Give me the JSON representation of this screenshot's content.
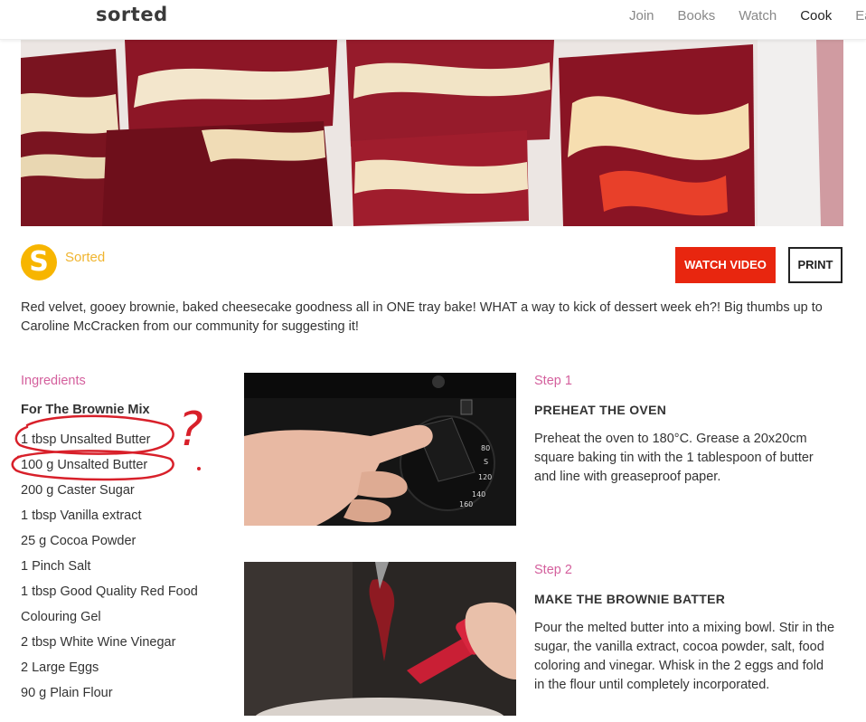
{
  "header": {
    "logo": "sorted",
    "nav": [
      "Join",
      "Books",
      "Watch",
      "Cook",
      "Ea"
    ],
    "active_nav": "Cook"
  },
  "author": {
    "avatar_letter": "S",
    "name": "Sorted"
  },
  "buttons": {
    "watch_video": "WATCH VIDEO",
    "print": "PRINT"
  },
  "intro": "Red velvet, gooey brownie, baked cheesecake goodness all in ONE tray bake! WHAT a way to kick of dessert week eh?! Big thumbs up to Caroline McCracken from our community for suggesting it!",
  "ingredients": {
    "label": "Ingredients",
    "heading": "For The Brownie Mix",
    "items": [
      "1 tbsp Unsalted Butter",
      "100 g Unsalted Butter",
      "200 g Caster Sugar",
      "1 tbsp Vanilla extract",
      "25 g Cocoa Powder",
      "1 Pinch Salt",
      "1 tbsp Good Quality Red Food",
      "Colouring Gel",
      "2 tbsp White Wine Vinegar",
      "2 Large Eggs",
      "90 g Plain Flour"
    ]
  },
  "steps": [
    {
      "label": "Step 1",
      "title": "PREHEAT THE OVEN",
      "body": "Preheat the oven to 180°C. Grease a 20x20cm square baking tin with the 1 tablespoon of butter and line with greaseproof paper."
    },
    {
      "label": "Step 2",
      "title": "MAKE THE BROWNIE BATTER",
      "body": "Pour the melted butter into a mixing bowl. Stir in the sugar, the vanilla extract, cocoa powder, salt, food coloring and vinegar. Whisk in the 2 eggs and fold in the flour until completely incorporated."
    }
  ],
  "oven_dial": {
    "marks": [
      "80",
      "S",
      "120",
      "140",
      "160"
    ]
  },
  "annotation": {
    "question_mark": "?",
    "color": "#d8202a"
  },
  "colors": {
    "accent_pink": "#d4609d",
    "author_yellow": "#f0b530",
    "watch_red": "#e8260f",
    "avatar_yellow": "#f7b500"
  }
}
